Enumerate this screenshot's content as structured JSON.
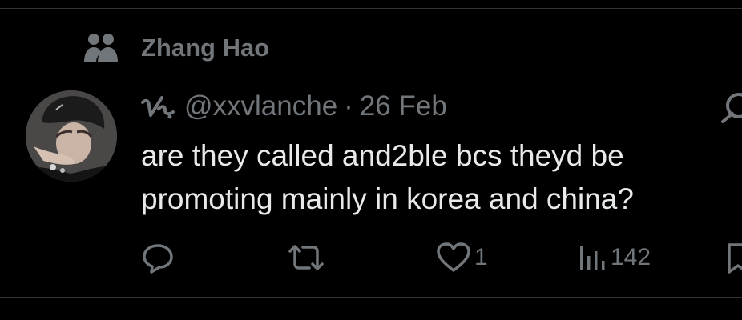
{
  "context": {
    "label": "Zhang Hao",
    "icon": "community-icon"
  },
  "tweet": {
    "handle": "@xxvlanche",
    "separator": "·",
    "date": "26 Feb",
    "text": "are they called and2ble bcs theyd be promoting mainly in korea and china?"
  },
  "actions": {
    "reply": {
      "icon": "reply-icon",
      "count": ""
    },
    "retweet": {
      "icon": "retweet-icon",
      "count": ""
    },
    "like": {
      "icon": "heart-icon",
      "count": "1"
    },
    "views": {
      "icon": "views-icon",
      "count": "142"
    },
    "bookmark": {
      "icon": "bookmark-icon"
    }
  },
  "colors": {
    "background": "#000000",
    "text": "#e7e9ea",
    "secondary": "#71767b",
    "divider": "#2f3336"
  }
}
